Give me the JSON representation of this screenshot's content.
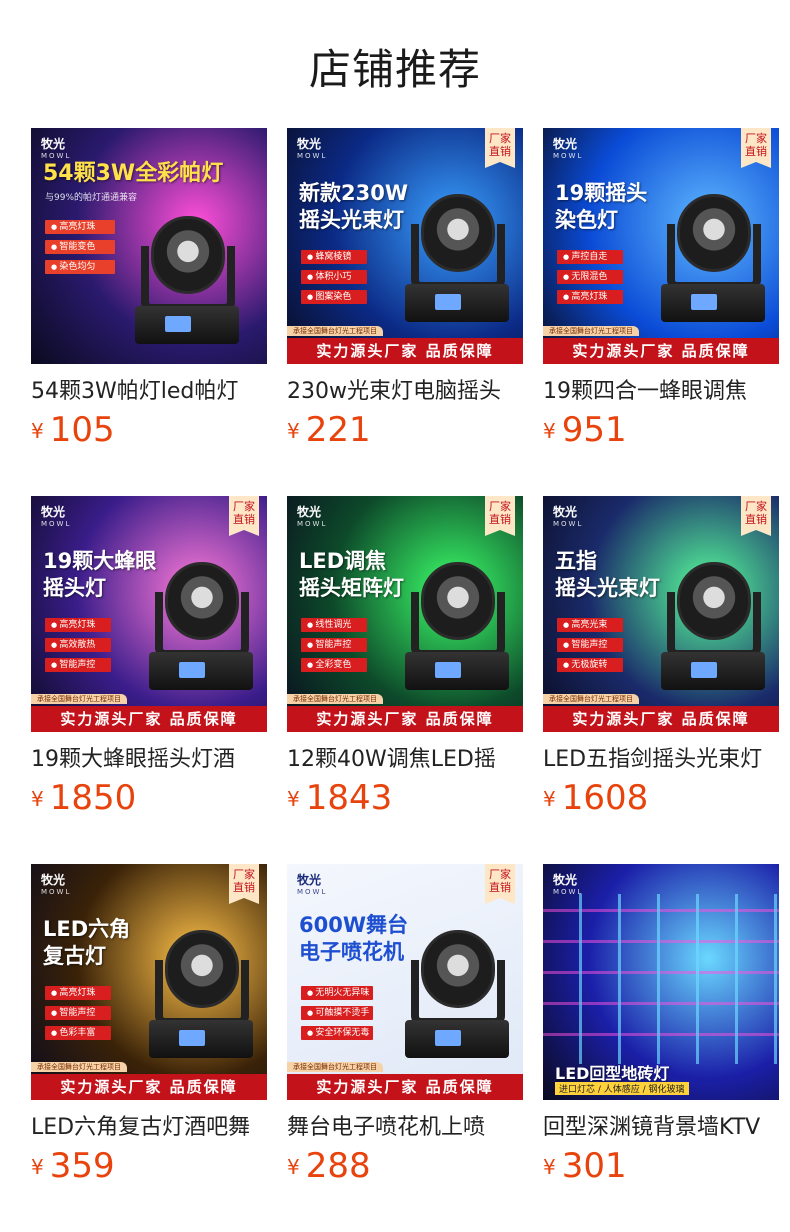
{
  "page": {
    "title": "店铺推荐"
  },
  "thumb_common": {
    "brand": "牧光",
    "brand_sub": "MOWL",
    "factory_badge": "厂家\n直销",
    "project_tag": "承接全国舞台灯光工程项目",
    "banner": "实力源头厂家 品质保障"
  },
  "products": [
    {
      "name": "54颗3W帕灯led帕灯",
      "price": "105",
      "currency": "¥",
      "image": {
        "headline": "54颗3W全彩帕灯",
        "subline": "与99%的帕灯通通兼容",
        "features": [
          "高亮灯珠",
          "智能变色",
          "染色均匀"
        ],
        "bg": "#2a1a6e",
        "accent": "#ff4fd8"
      }
    },
    {
      "name": "230w光束灯电脑摇头",
      "price": "221",
      "currency": "¥",
      "image": {
        "headline": "新款230W\n摇头光束灯",
        "subline": "",
        "features": [
          "蜂窝棱镜",
          "体积小巧",
          "图案染色"
        ],
        "bg": "#0b2a86",
        "accent": "#3aa0ff"
      }
    },
    {
      "name": "19颗四合一蜂眼调焦",
      "price": "951",
      "currency": "¥",
      "image": {
        "headline": "19颗摇头\n染色灯",
        "subline": "",
        "features": [
          "声控自走",
          "无限混色",
          "高亮灯珠"
        ],
        "bg": "#0a4bd6",
        "accent": "#5fb8ff"
      }
    },
    {
      "name": "19颗大蜂眼摇头灯酒",
      "price": "1850",
      "currency": "¥",
      "image": {
        "headline": "19颗大蜂眼\n摇头灯",
        "subline": "",
        "features": [
          "高亮灯珠",
          "高效散热",
          "智能声控"
        ],
        "bg": "#3a1d8a",
        "accent": "#ff7ad9"
      }
    },
    {
      "name": "12颗40W调焦LED摇",
      "price": "1843",
      "currency": "¥",
      "image": {
        "headline": "LED调焦\n摇头矩阵灯",
        "subline": "",
        "features": [
          "线性调光",
          "智能声控",
          "全彩变色"
        ],
        "bg": "#0d4a2a",
        "accent": "#3cff6a"
      }
    },
    {
      "name": "LED五指剑摇头光束灯",
      "price": "1608",
      "currency": "¥",
      "image": {
        "headline": "五指\n摇头光束灯",
        "subline": "",
        "features": [
          "高亮光束",
          "智能声控",
          "无极旋转"
        ],
        "bg": "#1a2a6a",
        "accent": "#58ff9a"
      }
    },
    {
      "name": "LED六角复古灯酒吧舞",
      "price": "359",
      "currency": "¥",
      "image": {
        "headline": "LED六角\n复古灯",
        "subline": "",
        "features": [
          "高亮灯珠",
          "智能声控",
          "色彩丰富"
        ],
        "bg": "#3a2208",
        "accent": "#ffc24a"
      }
    },
    {
      "name": "舞台电子喷花机上喷",
      "price": "288",
      "currency": "¥",
      "image": {
        "headline": "600W舞台\n电子喷花机",
        "subline": "",
        "features": [
          "无明火无异味",
          "可触摸不烫手",
          "安全环保无毒"
        ],
        "bg": "#dfe8f7",
        "accent": "#2a5bd7"
      }
    },
    {
      "name": "回型深渊镜背景墙KTV",
      "price": "301",
      "currency": "¥",
      "image": {
        "headline": "LED回型地砖灯",
        "subline": "进口灯芯 / 人体感应 / 钢化玻璃",
        "features": [],
        "bg": "#1b1fa8",
        "accent": "#6ad8ff"
      }
    }
  ]
}
